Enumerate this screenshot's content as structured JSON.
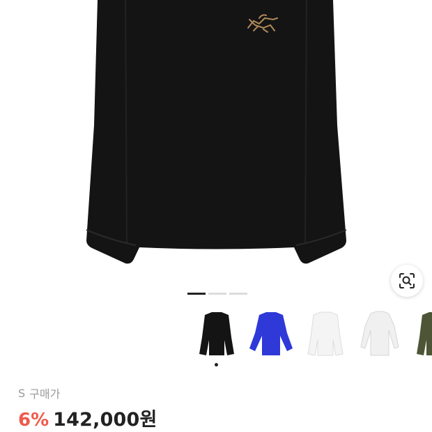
{
  "product": {
    "size_label": "S",
    "price_type_label": "구매가",
    "discount": "6%",
    "price": "142,000원"
  },
  "gallery": {
    "page_count": 3,
    "active_page": 1,
    "thumbnails": [
      {
        "name": "black",
        "color": "#1a1a1a"
      },
      {
        "name": "blue",
        "color": "#2f39d8"
      },
      {
        "name": "white",
        "color": "#f2f2f2"
      },
      {
        "name": "white-longsleeve",
        "color": "#ececec"
      },
      {
        "name": "olive",
        "color": "#4d5536"
      }
    ],
    "selected_index": 0
  },
  "icons": {
    "lens": "image-search-icon"
  }
}
